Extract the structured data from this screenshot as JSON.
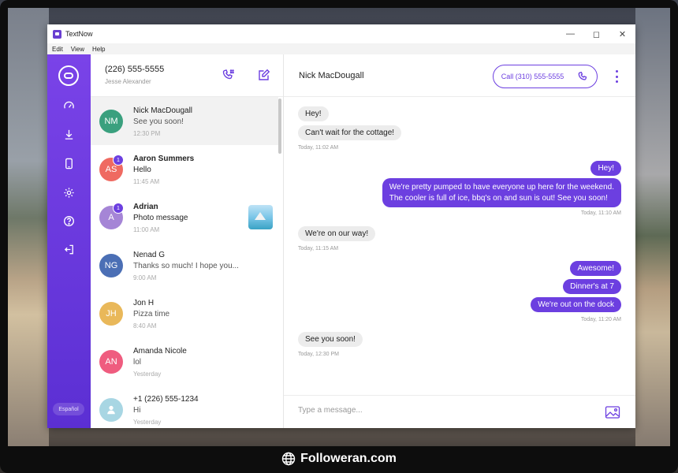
{
  "window": {
    "title": "TextNow"
  },
  "menu": [
    "Edit",
    "View",
    "Help"
  ],
  "sidebar": {
    "language_label": "Español",
    "icons": [
      "speedometer-icon",
      "download-icon",
      "phone-device-icon",
      "gear-icon",
      "help-icon",
      "logout-icon"
    ]
  },
  "account": {
    "number": "(226) 555-5555",
    "name": "Jesse Alexander"
  },
  "conversations": [
    {
      "initials": "NM",
      "name": "Nick MacDougall",
      "snippet": "See you soon!",
      "time": "12:30 PM",
      "color": "#3aa07e",
      "unread": "",
      "active": true
    },
    {
      "initials": "AS",
      "name": "Aaron Summers",
      "snippet": "Hello",
      "time": "11:45 AM",
      "color": "#ef6a61",
      "unread": "1"
    },
    {
      "initials": "A",
      "name": "Adrian",
      "snippet": "Photo message",
      "time": "11:00 AM",
      "color": "#a585d6",
      "unread": "1"
    },
    {
      "initials": "NG",
      "name": "Nenad G",
      "snippet": "Thanks so much! I hope you...",
      "time": "9:00 AM",
      "color": "#4b6fb5",
      "unread": ""
    },
    {
      "initials": "JH",
      "name": "Jon H",
      "snippet": "Pizza time",
      "time": "8:40 AM",
      "color": "#e9b85a",
      "unread": ""
    },
    {
      "initials": "AN",
      "name": "Amanda Nicole",
      "snippet": "lol",
      "time": "Yesterday",
      "color": "#ef5c7f",
      "unread": ""
    },
    {
      "initials": "",
      "name": "+1 (226) 555-1234",
      "snippet": "Hi",
      "time": "Yesterday",
      "color": "#a8d6e3",
      "unread": ""
    }
  ],
  "chat": {
    "contact": "Nick MacDougall",
    "call_label": "Call (310) 555-5555",
    "messages": {
      "m1": "Hey!",
      "m2": "Can't wait for the cottage!",
      "t1": "Today, 11:02 AM",
      "m3": "Hey!",
      "m4_line1": "We're pretty pumped to have everyone up here for the weekend.",
      "m4_line2": "The cooler is full of ice, bbq's on and sun is out!  See you soon!",
      "t2": "Today, 11:10 AM",
      "m5": "We're on our way!",
      "t3": "Today, 11:15 AM",
      "m6": "Awesome!",
      "m7": "Dinner's at 7",
      "m8": "We're out on the dock",
      "t4": "Today, 11:20 AM",
      "m9": "See you soon!",
      "t5": "Today, 12:30 PM"
    },
    "composer_placeholder": "Type a message..."
  },
  "watermark": "Followeran.com",
  "colors": {
    "accent": "#6c3fe0"
  }
}
